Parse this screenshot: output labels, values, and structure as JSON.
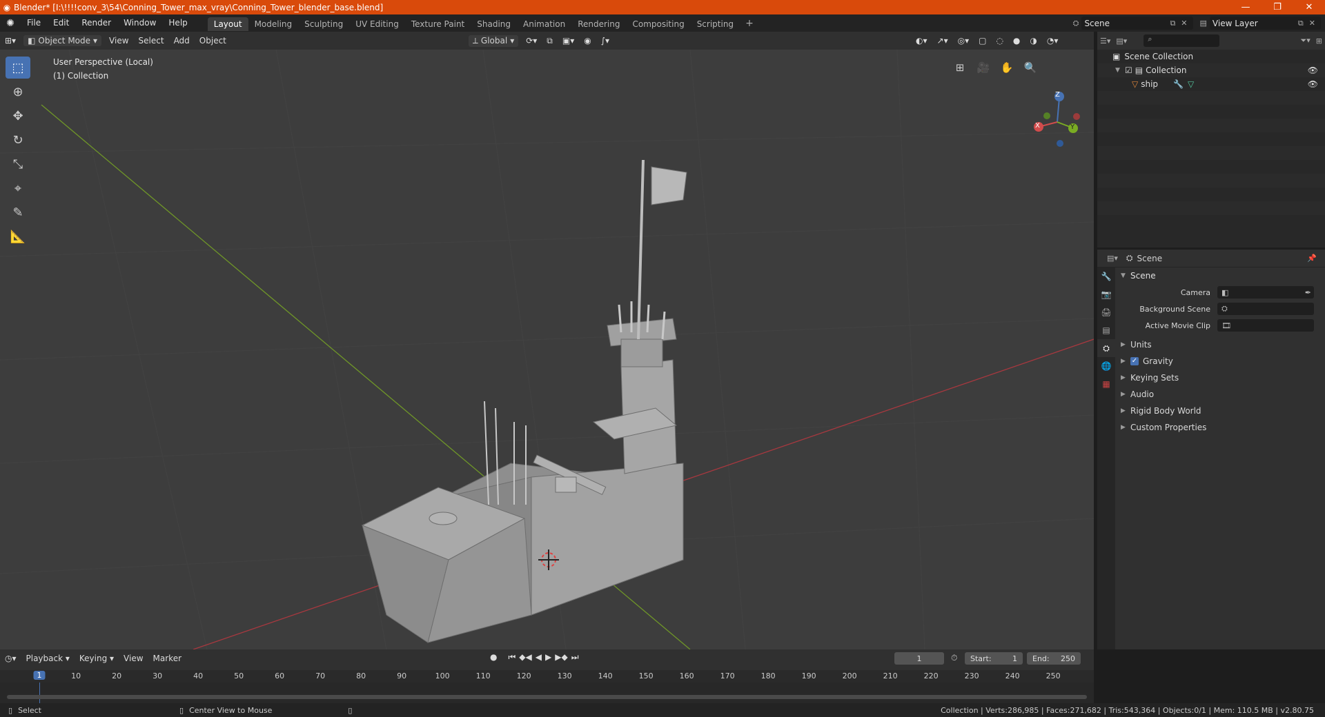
{
  "window": {
    "title": "Blender* [I:\\!!!!conv_3\\54\\Conning_Tower_max_vray\\Conning_Tower_blender_base.blend]",
    "minimize_icon": "minimize-icon",
    "maximize_icon": "restore-icon",
    "close_icon": "close-icon"
  },
  "menu": [
    "File",
    "Edit",
    "Render",
    "Window",
    "Help"
  ],
  "workspaces": [
    "Layout",
    "Modeling",
    "Sculpting",
    "UV Editing",
    "Texture Paint",
    "Shading",
    "Animation",
    "Rendering",
    "Compositing",
    "Scripting"
  ],
  "active_workspace": "Layout",
  "scene_selector": {
    "value": "Scene"
  },
  "view_layer_selector": {
    "value": "View Layer"
  },
  "viewport_header": {
    "mode": "Object Mode",
    "menus": [
      "View",
      "Select",
      "Add",
      "Object"
    ],
    "orientation": "Global"
  },
  "viewport": {
    "perspective_label": "User Perspective (Local)",
    "collection_label": "(1) Collection",
    "gizmo_axes": {
      "x": "X",
      "y": "Y",
      "z": "Z"
    },
    "colors": {
      "background": "#3d3d3d",
      "x_axis": "#a8383f",
      "y_axis": "#6f9628",
      "model": "#9a9a9a"
    }
  },
  "tools": [
    "select-box",
    "cursor",
    "move",
    "rotate",
    "scale",
    "transform",
    "annotate",
    "measure"
  ],
  "outliner": {
    "root": "Scene Collection",
    "collection": "Collection",
    "object": "ship"
  },
  "properties": {
    "header_title": "Scene",
    "panel_title": "Scene",
    "rows": [
      {
        "label": "Camera",
        "value": ""
      },
      {
        "label": "Background Scene",
        "value": ""
      },
      {
        "label": "Active Movie Clip",
        "value": ""
      }
    ],
    "sections": [
      "Units",
      "Gravity",
      "Keying Sets",
      "Audio",
      "Rigid Body World",
      "Custom Properties"
    ],
    "gravity_checked": true
  },
  "timeline": {
    "menus": [
      "Playback",
      "Keying",
      "View",
      "Marker"
    ],
    "current_frame": "1",
    "start_label": "Start:",
    "start": "1",
    "end_label": "End:",
    "end": "250",
    "ruler": [
      "10",
      "20",
      "30",
      "40",
      "50",
      "60",
      "70",
      "80",
      "90",
      "100",
      "110",
      "120",
      "130",
      "140",
      "150",
      "160",
      "170",
      "180",
      "190",
      "200",
      "210",
      "220",
      "230",
      "240",
      "250"
    ],
    "ruler_current": "1"
  },
  "status": {
    "left_action": "Select",
    "middle_action": "Center View to Mouse",
    "stats": "Collection | Verts:286,985 | Faces:271,682 | Tris:543,364 | Objects:0/1 | Mem: 110.5 MB | v2.80.75"
  }
}
